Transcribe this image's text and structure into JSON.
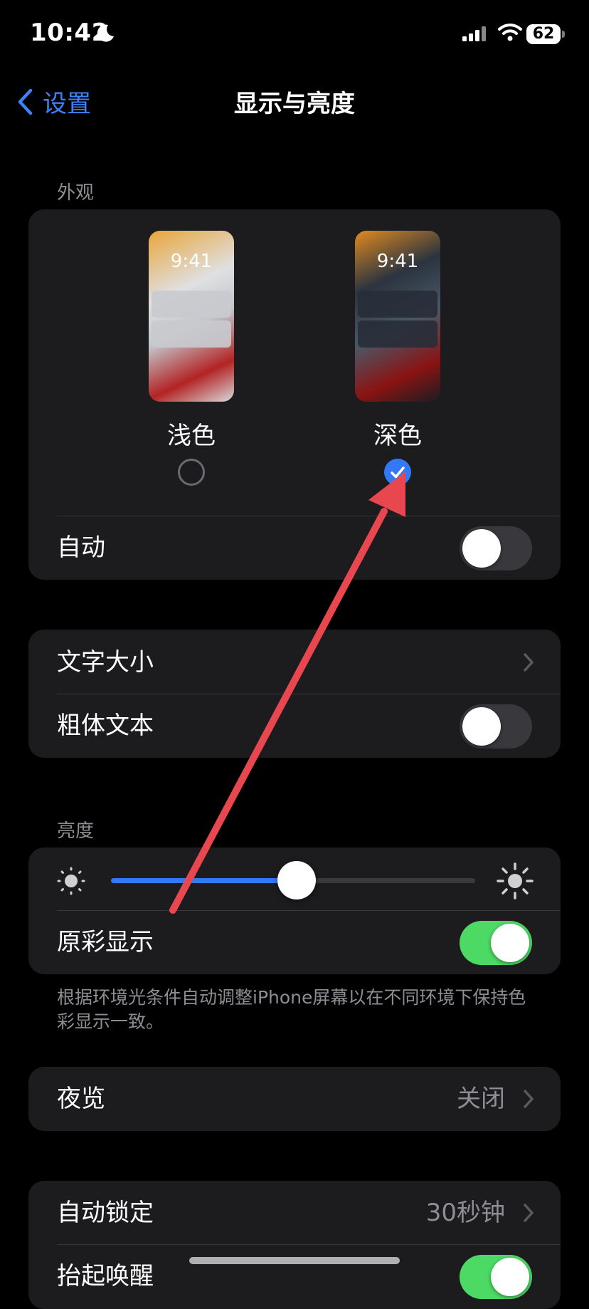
{
  "status_bar": {
    "time": "10:42",
    "battery": "62"
  },
  "nav": {
    "back_label": "设置",
    "title": "显示与亮度"
  },
  "appearance": {
    "section_label": "外观",
    "light": {
      "preview_time": "9:41",
      "label": "浅色",
      "selected": false
    },
    "dark": {
      "preview_time": "9:41",
      "label": "深色",
      "selected": true
    },
    "auto_label": "自动",
    "auto_on": false
  },
  "text": {
    "text_size_label": "文字大小",
    "bold_text_label": "粗体文本",
    "bold_text_on": false
  },
  "brightness": {
    "section_label": "亮度",
    "level": 0.51,
    "true_tone_label": "原彩显示",
    "true_tone_on": true,
    "footnote": "根据环境光条件自动调整iPhone屏幕以在不同环境下保持色彩显示一致。"
  },
  "night_shift": {
    "label": "夜览",
    "value": "关闭"
  },
  "lock": {
    "auto_lock_label": "自动锁定",
    "auto_lock_value": "30秒钟",
    "raise_to_wake_label": "抬起唤醒",
    "raise_to_wake_on": true
  },
  "colors": {
    "accent": "#3478f6",
    "toggle_on": "#4cd964",
    "annotation_arrow": "#e8474f"
  }
}
